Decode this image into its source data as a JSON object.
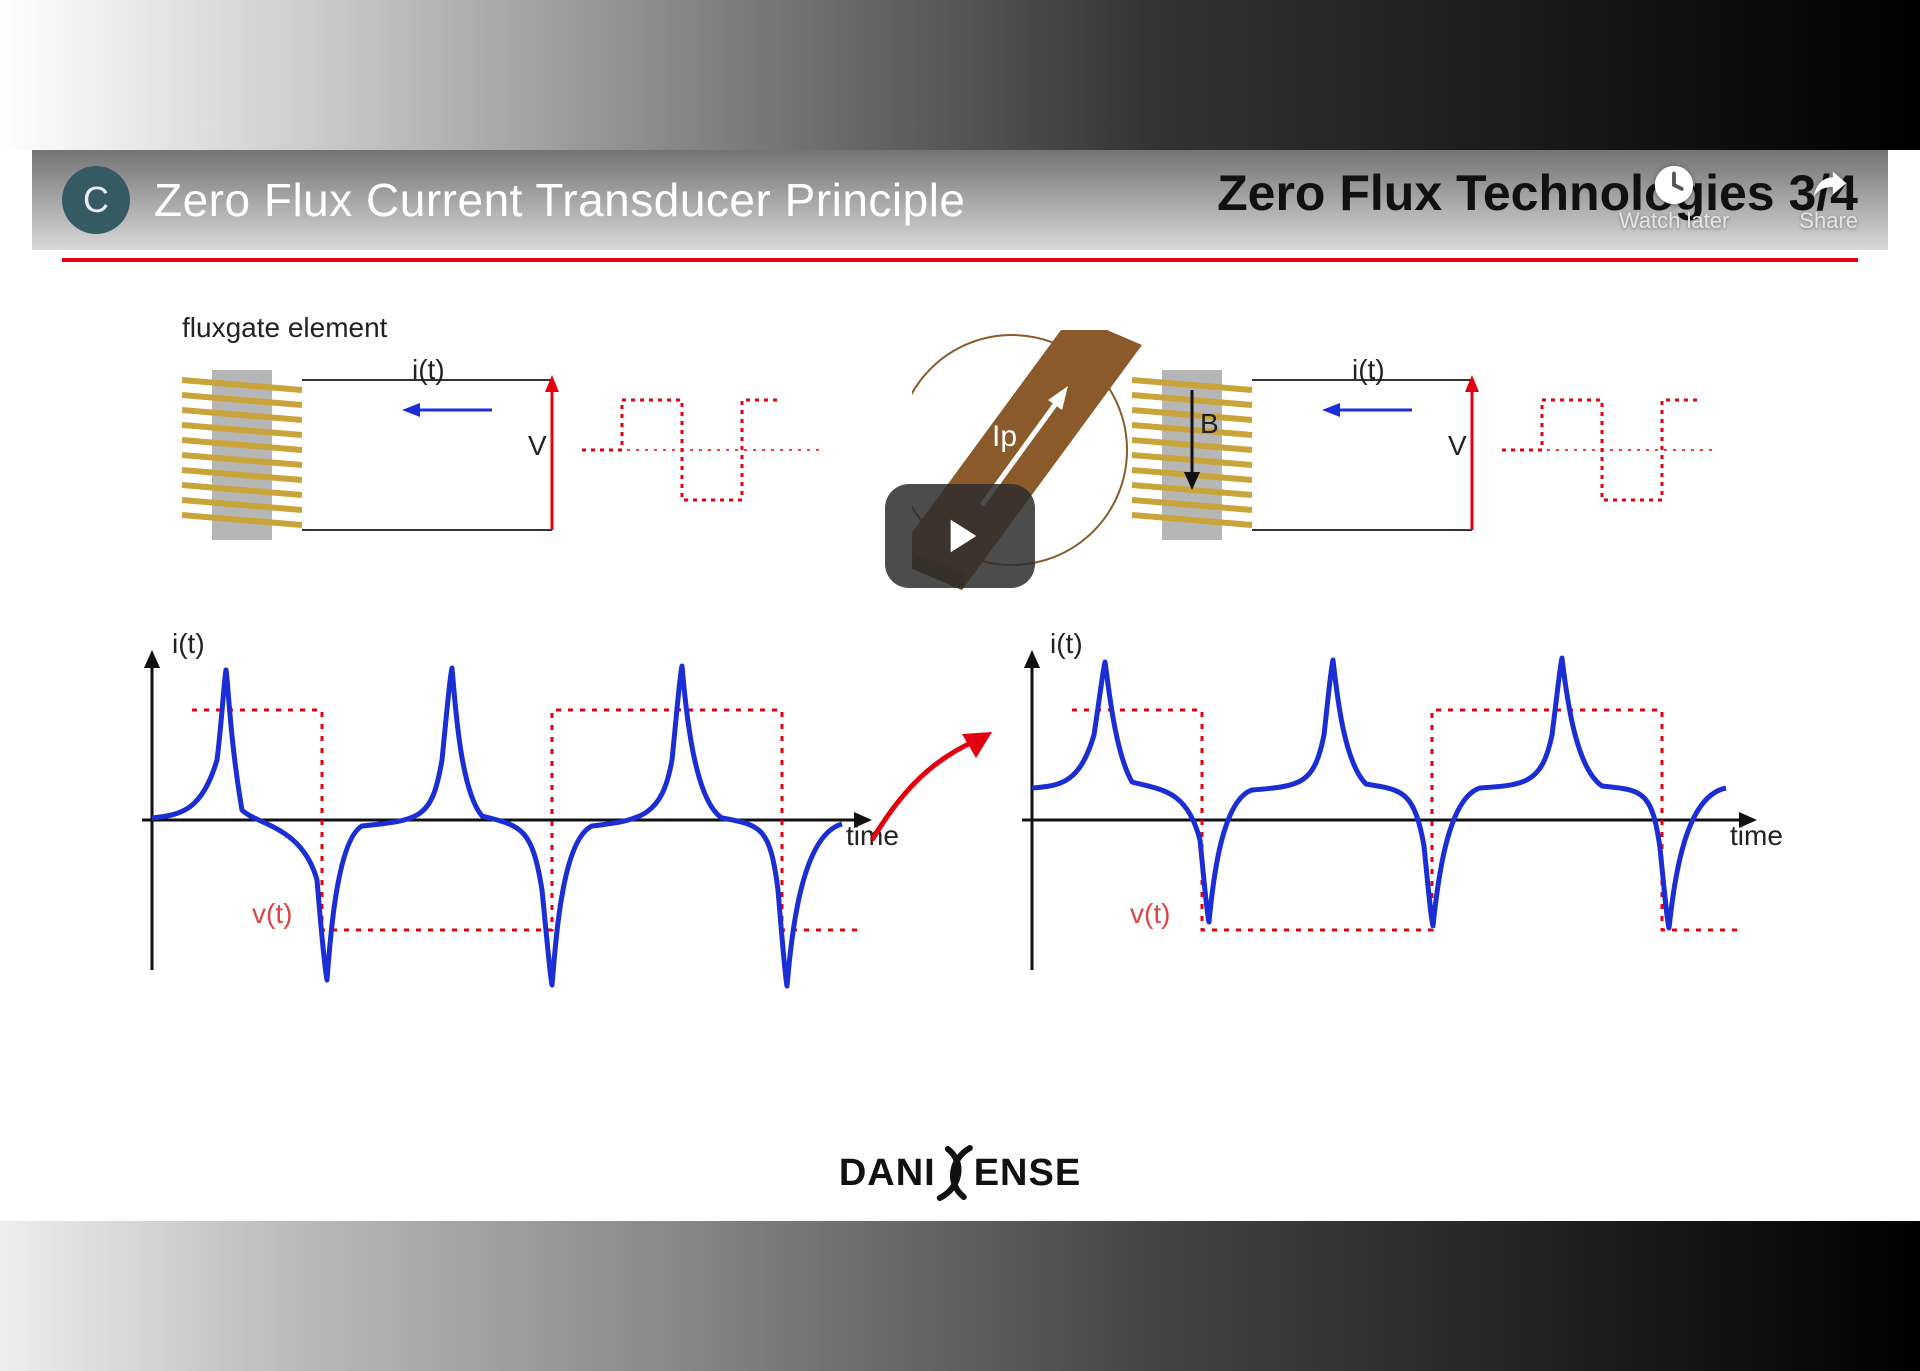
{
  "player": {
    "avatar_letter": "C",
    "video_title": "Zero Flux Current Transducer Principle",
    "watch_later": "Watch later",
    "share": "Share"
  },
  "slide": {
    "title": "Zero Flux Technologies 3/4"
  },
  "labels": {
    "fluxgate": "fluxgate element",
    "i_t_top1": "i(t)",
    "i_t_top2": "i(t)",
    "V1": "V",
    "V2": "V",
    "Ip": "Ip",
    "B": "B",
    "i_t_plot1": "i(t)",
    "i_t_plot2": "i(t)",
    "time1": "time",
    "time2": "time",
    "v_t1": "v(t)",
    "v_t2": "v(t)"
  },
  "brand": {
    "part1": "DANI",
    "part2": "ENSE"
  },
  "colors": {
    "accent_red": "#e3000f",
    "signal_blue": "#1b2ed6",
    "copper": "#8a5a2b",
    "coil_gold": "#c9a43a",
    "grey_core": "#b6b6b6"
  }
}
